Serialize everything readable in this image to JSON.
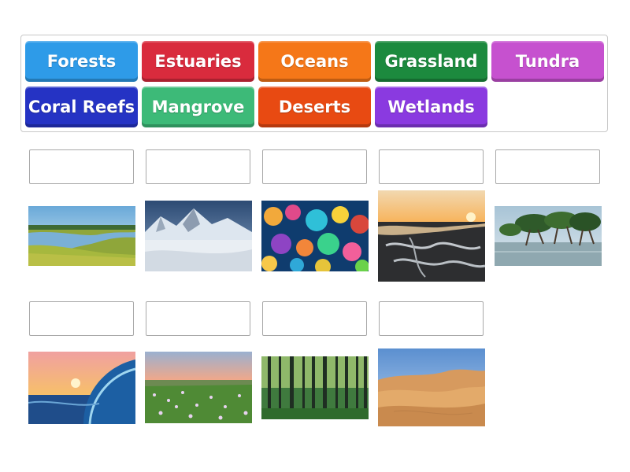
{
  "tiles": [
    {
      "label": "Forests",
      "color": "#2e9be8"
    },
    {
      "label": "Estuaries",
      "color": "#d92b3d"
    },
    {
      "label": "Oceans",
      "color": "#f57718"
    },
    {
      "label": "Grassland",
      "color": "#1c8a3e"
    },
    {
      "label": "Tundra",
      "color": "#c651cf"
    },
    {
      "label": "Coral Reefs",
      "color": "#2533c4"
    },
    {
      "label": "Mangrove",
      "color": "#3dba78"
    },
    {
      "label": "Deserts",
      "color": "#e84a12"
    },
    {
      "label": "Wetlands",
      "color": "#8a3ae0"
    }
  ],
  "pictures": [
    {
      "name": "wetland-marsh-image",
      "icon": "marsh-photo"
    },
    {
      "name": "snowy-mountain-image",
      "icon": "tundra-photo"
    },
    {
      "name": "coral-reef-image",
      "icon": "coral-photo"
    },
    {
      "name": "river-delta-image",
      "icon": "estuary-photo"
    },
    {
      "name": "mangrove-trees-image",
      "icon": "mangrove-photo"
    },
    {
      "name": "ocean-wave-image",
      "icon": "wave-photo"
    },
    {
      "name": "flower-meadow-image",
      "icon": "grassland-photo"
    },
    {
      "name": "forest-trees-image",
      "icon": "forest-photo"
    },
    {
      "name": "sand-dunes-image",
      "icon": "desert-photo"
    }
  ]
}
